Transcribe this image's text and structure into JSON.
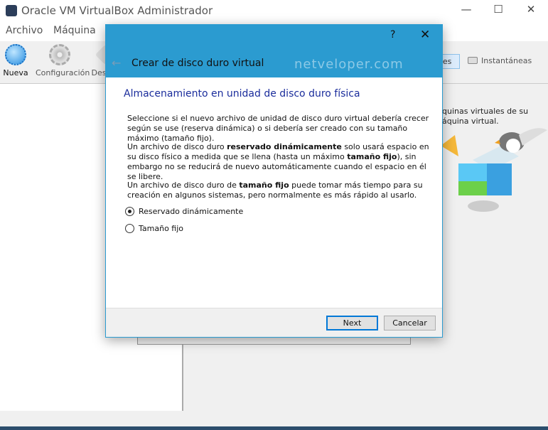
{
  "window": {
    "title": "Oracle VM VirtualBox Administrador",
    "minimize": "—",
    "maximize": "☐",
    "close": "✕"
  },
  "menu": [
    "Archivo",
    "Máquina"
  ],
  "toolbar": [
    {
      "label": "Nueva"
    },
    {
      "label": "Configuración"
    },
    {
      "label": "Des"
    }
  ],
  "tabs": {
    "details": "alles",
    "snapshots": "Instantáneas"
  },
  "welcome": "quinas virtuales de su\náquina virtual.",
  "dialog": {
    "help": "?",
    "close": "✕",
    "back": "←",
    "title": "Crear de disco duro virtual",
    "watermark": "netveloper.com",
    "heading": "Almacenamiento en unidad de disco duro física",
    "p1": "Seleccione si el nuevo archivo de unidad de disco duro virtual debería crecer según se use (reserva dinámica) o si debería ser creado con su tamaño máximo (tamaño fijo).",
    "p2": {
      "a": "Un archivo de disco duro ",
      "b": "reservado dinámicamente",
      "c": " solo usará espacio en su disco físico a medida que se llena (hasta un máximo ",
      "d": "tamaño fijo",
      "e": "), sin embargo no se reducirá de nuevo automáticamente cuando el espacio en él se libere."
    },
    "p3": {
      "a": "Un archivo de disco duro de ",
      "b": "tamaño fijo",
      "c": " puede tomar más tiempo para su creación en algunos sistemas, pero normalmente es más rápido al usarlo."
    },
    "options": [
      {
        "label": "Reservado dinámicamente",
        "selected": true
      },
      {
        "label": "Tamaño fijo",
        "selected": false
      }
    ],
    "next": "Next",
    "cancel": "Cancelar"
  },
  "colors": {
    "accent": "#2b9bd0",
    "heading": "#1b2d9c",
    "focus": "#0078d7"
  }
}
